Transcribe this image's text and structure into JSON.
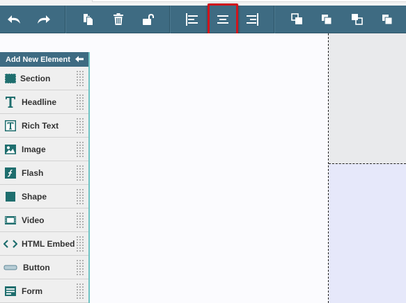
{
  "toolbar": {
    "buttons": [
      {
        "name": "undo-button",
        "icon": "undo-icon"
      },
      {
        "name": "redo-button",
        "icon": "redo-icon"
      },
      {
        "name": "copy-button",
        "icon": "copy-icon"
      },
      {
        "name": "delete-button",
        "icon": "trash-icon"
      },
      {
        "name": "lock-button",
        "icon": "unlock-icon"
      },
      {
        "name": "align-left-button",
        "icon": "align-left-icon"
      },
      {
        "name": "align-center-button",
        "icon": "align-center-icon",
        "highlighted": true
      },
      {
        "name": "align-right-button",
        "icon": "align-right-icon"
      },
      {
        "name": "bring-to-front-button",
        "icon": "bring-to-front-icon"
      },
      {
        "name": "bring-forward-button",
        "icon": "bring-forward-icon"
      },
      {
        "name": "send-backward-button",
        "icon": "send-backward-icon"
      },
      {
        "name": "send-to-back-button",
        "icon": "send-to-back-icon"
      }
    ],
    "highlight_color": "#d0141c"
  },
  "panel": {
    "title": "Add New Element",
    "items": [
      {
        "label": "Section",
        "icon": "section-icon"
      },
      {
        "label": "Headline",
        "icon": "headline-icon"
      },
      {
        "label": "Rich Text",
        "icon": "rich-text-icon"
      },
      {
        "label": "Image",
        "icon": "image-icon"
      },
      {
        "label": "Flash",
        "icon": "flash-icon"
      },
      {
        "label": "Shape",
        "icon": "shape-icon"
      },
      {
        "label": "Video",
        "icon": "video-icon"
      },
      {
        "label": "HTML Embed",
        "icon": "html-embed-icon"
      },
      {
        "label": "Button",
        "icon": "button-icon"
      },
      {
        "label": "Form",
        "icon": "form-icon"
      }
    ]
  },
  "colors": {
    "toolbar_bg": "#3e6b82",
    "accent_teal": "#1f6e6e",
    "panel_border": "#6fc3c3"
  }
}
